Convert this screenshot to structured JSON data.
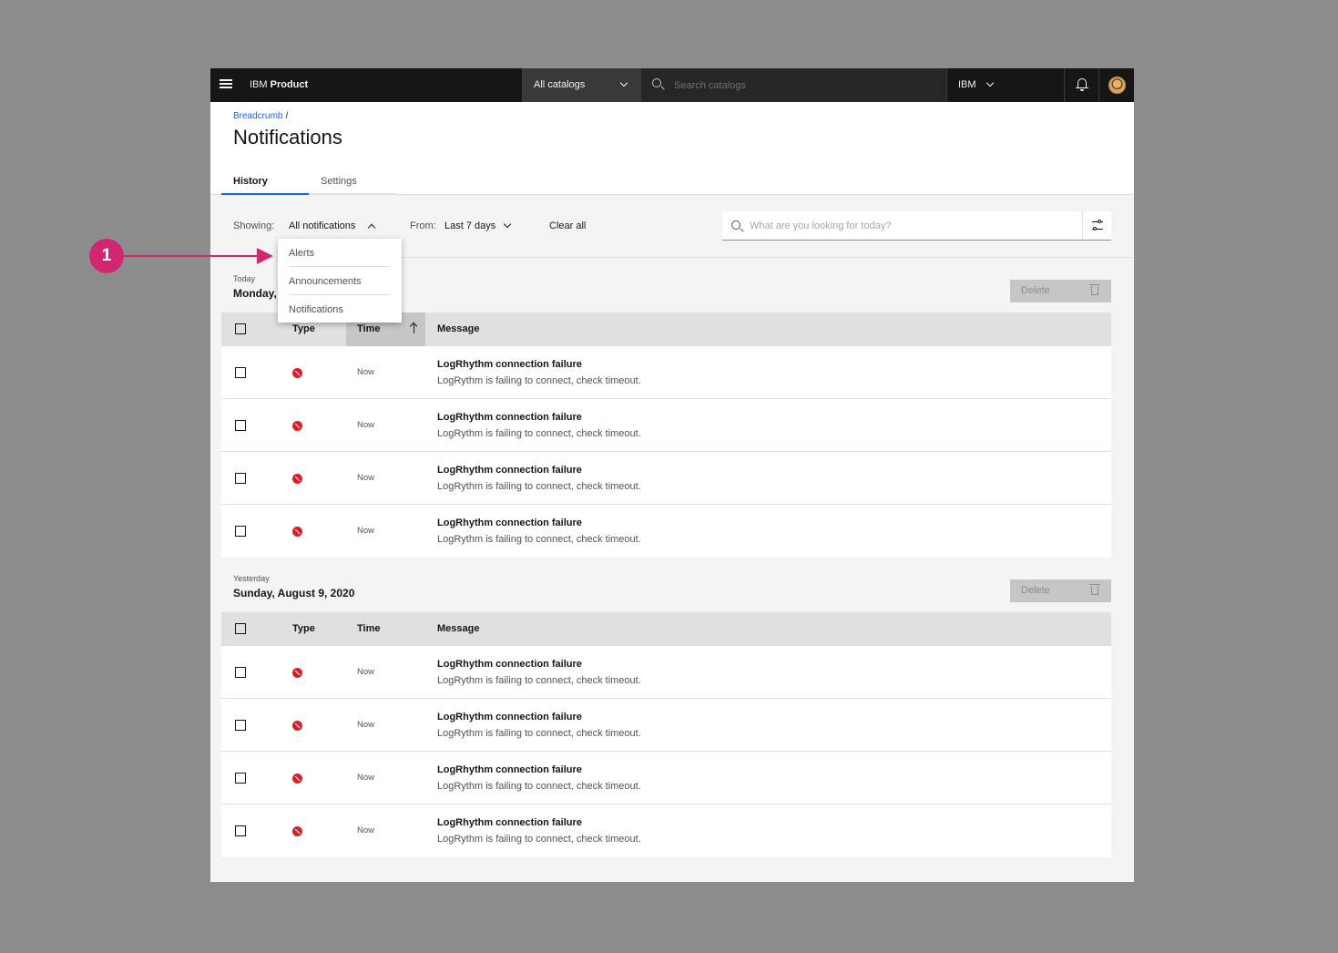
{
  "topnav": {
    "brand_prefix": "IBM",
    "brand_name": "Product",
    "catalog_dropdown": "All catalogs",
    "search_placeholder": "Search catalogs",
    "account": "IBM"
  },
  "breadcrumb": {
    "label": "Breadcrumb",
    "separator": "/"
  },
  "page_title": "Notifications",
  "tabs": [
    {
      "label": "History",
      "active": true
    },
    {
      "label": "Settings",
      "active": false
    }
  ],
  "filters": {
    "showing_label": "Showing:",
    "showing_value": "All notifications",
    "from_label": "From:",
    "from_value": "Last 7 days",
    "clear_all": "Clear all",
    "search_placeholder": "What are you looking for today?"
  },
  "showing_menu": {
    "open": true,
    "options": [
      "Alerts",
      "Announcements",
      "Notifications"
    ]
  },
  "annotation": {
    "number": "1",
    "color": "#d12771"
  },
  "columns": {
    "type": "Type",
    "time": "Time",
    "message": "Message"
  },
  "sections": [
    {
      "sub": "Today",
      "title": "Monday,",
      "delete_label": "Delete",
      "sorted_column": "Time",
      "rows": [
        {
          "time": "Now",
          "title": "LogRhythm connection failure",
          "desc": "LogRythm is failing to connect, check timeout."
        },
        {
          "time": "Now",
          "title": "LogRhythm connection failure",
          "desc": "LogRythm is failing to connect, check timeout."
        },
        {
          "time": "Now",
          "title": "LogRhythm connection failure",
          "desc": "LogRythm is failing to connect, check timeout."
        },
        {
          "time": "Now",
          "title": "LogRhythm connection failure",
          "desc": "LogRythm is failing to connect, check timeout."
        }
      ]
    },
    {
      "sub": "Yesterday",
      "title": "Sunday, August 9, 2020",
      "delete_label": "Delete",
      "rows": [
        {
          "time": "Now",
          "title": "LogRhythm connection failure",
          "desc": "LogRythm is failing to connect, check timeout."
        },
        {
          "time": "Now",
          "title": "LogRhythm connection failure",
          "desc": "LogRythm is failing to connect, check timeout."
        },
        {
          "time": "Now",
          "title": "LogRhythm connection failure",
          "desc": "LogRythm is failing to connect, check timeout."
        },
        {
          "time": "Now",
          "title": "LogRhythm connection failure",
          "desc": "LogRythm is failing to connect, check timeout."
        }
      ]
    }
  ],
  "colors": {
    "accent": "#0f62fe",
    "error": "#da1e28",
    "shell": "#161616"
  }
}
